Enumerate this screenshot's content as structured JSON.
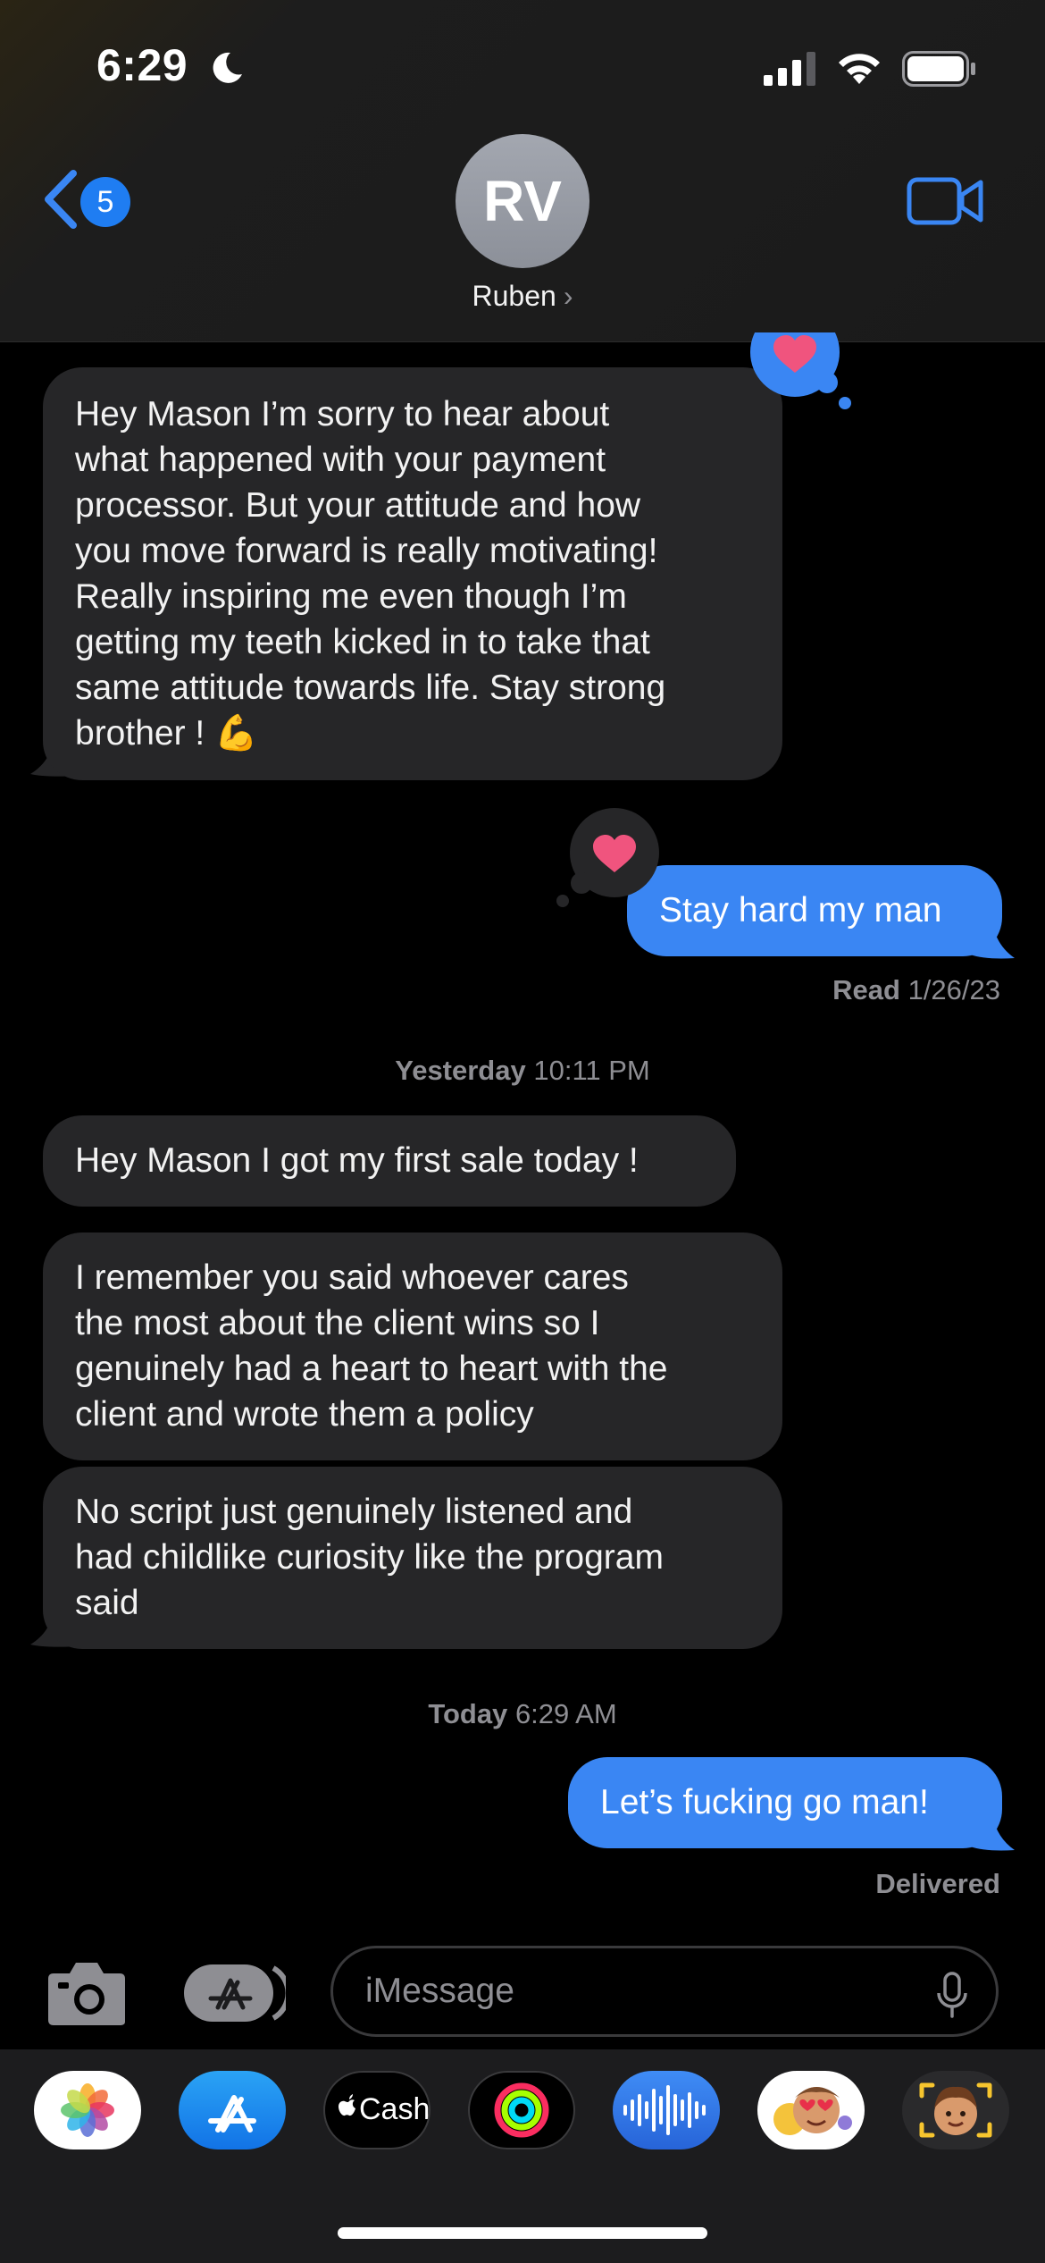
{
  "status_bar": {
    "time": "6:29"
  },
  "header": {
    "back_badge": "5",
    "avatar_initials": "RV",
    "contact_name": "Ruben"
  },
  "messages": [
    {
      "direction": "incoming",
      "text": "Hey Mason I’m sorry to hear about\nwhat happened with your payment\nprocessor. But your attitude and how\nyou move forward is really motivating!\nReally inspiring me even though I’m\ngetting my teeth kicked in to take that\nsame attitude towards life. Stay strong\nbrother ! 💪",
      "reaction": "heart"
    },
    {
      "direction": "outgoing",
      "text": "Stay hard my man",
      "reaction": "heart"
    },
    {
      "direction": "incoming",
      "text": "Hey Mason I got my first sale today !"
    },
    {
      "direction": "incoming",
      "text": "I remember you said whoever cares\nthe most about the client wins so I\ngenuinely had a heart to heart with the\nclient and wrote them a policy"
    },
    {
      "direction": "incoming",
      "text": "No script just genuinely listened and\nhad childlike curiosity like the program\nsaid"
    },
    {
      "direction": "outgoing",
      "text": "Let’s fucking go man!"
    }
  ],
  "receipts": {
    "read_label": "Read",
    "read_date": "1/26/23",
    "delivered": "Delivered"
  },
  "timestamps": [
    {
      "day": "Yesterday",
      "time": "10:11 PM"
    },
    {
      "day": "Today",
      "time": "6:29 AM"
    }
  ],
  "input": {
    "placeholder": "iMessage"
  },
  "apps": [
    {
      "icon": "photos-icon"
    },
    {
      "icon": "app-store-icon"
    },
    {
      "icon": "apple-cash-icon",
      "label": "Cash"
    },
    {
      "icon": "activity-rings-icon"
    },
    {
      "icon": "audio-message-icon"
    },
    {
      "icon": "memoji-stickers-icon"
    },
    {
      "icon": "memoji-icon"
    }
  ],
  "colors": {
    "accent_blue": "#3a86f3",
    "incoming_bubble": "#262628",
    "heart_pink": "#f0547e",
    "secondary_text": "#8e8e93"
  }
}
